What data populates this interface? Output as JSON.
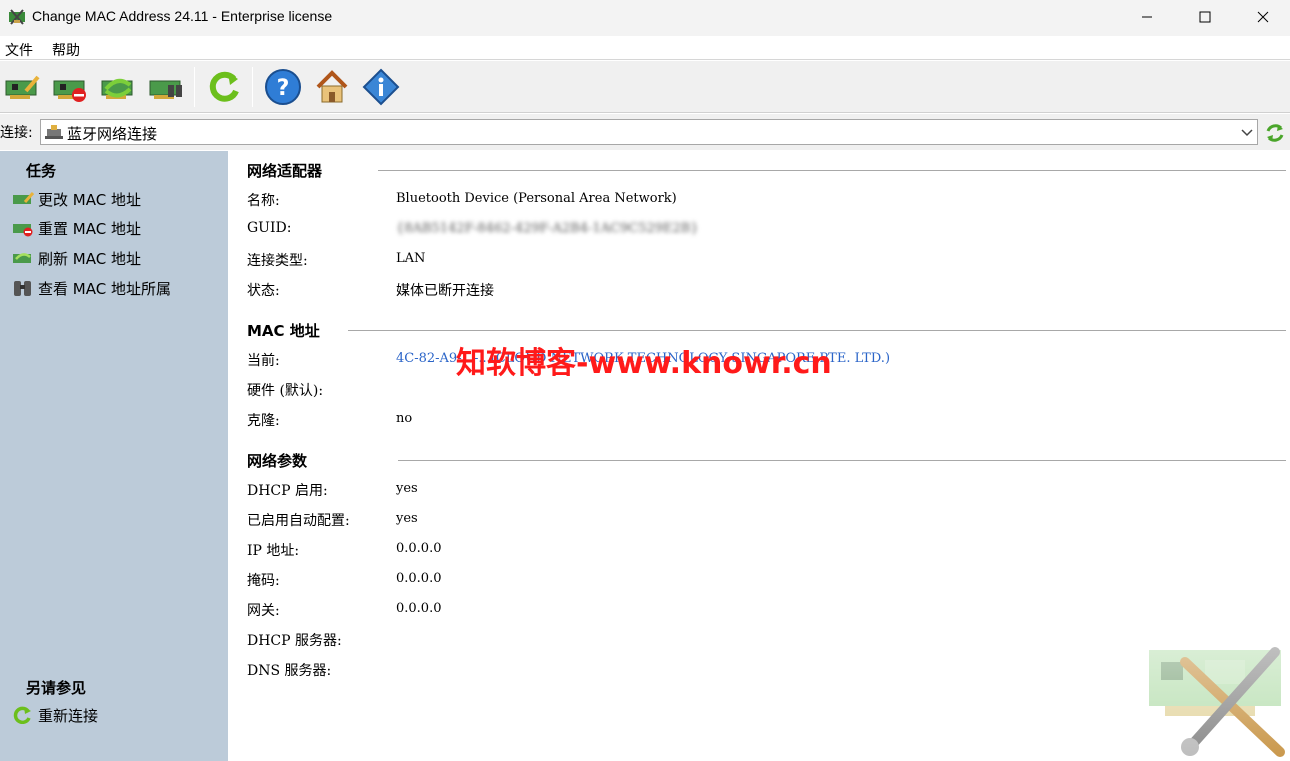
{
  "window": {
    "title": "Change MAC Address 24.11 - Enterprise license"
  },
  "menu": {
    "file": "文件",
    "help": "帮助"
  },
  "toolbar": {
    "buttons": [
      "change-mac",
      "reset-mac",
      "refresh-mac",
      "view-mac-owner",
      "reconnect",
      "help",
      "home",
      "about"
    ]
  },
  "connection": {
    "label": "连接:",
    "selected": "蓝牙网络连接"
  },
  "sidebar": {
    "tasks_heading": "任务",
    "tasks": [
      {
        "label": "更改 MAC 地址",
        "icon": "network-card-edit-icon"
      },
      {
        "label": "重置 MAC 地址",
        "icon": "network-card-reset-icon"
      },
      {
        "label": "刷新 MAC 地址",
        "icon": "network-card-refresh-icon"
      },
      {
        "label": "查看 MAC 地址所属",
        "icon": "binoculars-icon"
      }
    ],
    "see_also_heading": "另请参见",
    "see_also": [
      {
        "label": "重新连接",
        "icon": "reconnect-icon"
      }
    ]
  },
  "adapter": {
    "heading": "网络适配器",
    "name_label": "名称:",
    "name_value": "Bluetooth Device (Personal Area Network)",
    "guid_label": "GUID:",
    "guid_value": "{8AB5142F-8462-429F-A2B4-1AC9C529E2B}",
    "type_label": "连接类型:",
    "type_value": "LAN",
    "status_label": "状态:",
    "status_value": "媒体已断开连接"
  },
  "mac": {
    "heading": "MAC 地址",
    "current_label": "当前:",
    "current_value": "4C-82-A9-...-.. (CLOUD NETWORK TECHNOLOGY SINGAPORE PTE. LTD.)",
    "hardware_label": "硬件 (默认):",
    "hardware_value": "",
    "clone_label": "克隆:",
    "clone_value": "no"
  },
  "params": {
    "heading": "网络参数",
    "dhcp_label": "DHCP 启用:",
    "dhcp_value": "yes",
    "autoconf_label": "已启用自动配置:",
    "autoconf_value": "yes",
    "ip_label": "IP 地址:",
    "ip_value": "0.0.0.0",
    "mask_label": "掩码:",
    "mask_value": "0.0.0.0",
    "gateway_label": "网关:",
    "gateway_value": "0.0.0.0",
    "dhcp_server_label": "DHCP 服务器:",
    "dhcp_server_value": "",
    "dns_label": "DNS 服务器:",
    "dns_value": ""
  },
  "watermark": "知软博客-www.knowr.cn",
  "colors": {
    "sidebar_bg": "#bccbd9",
    "link": "#2a64c8",
    "watermark": "#ff1a1a"
  }
}
